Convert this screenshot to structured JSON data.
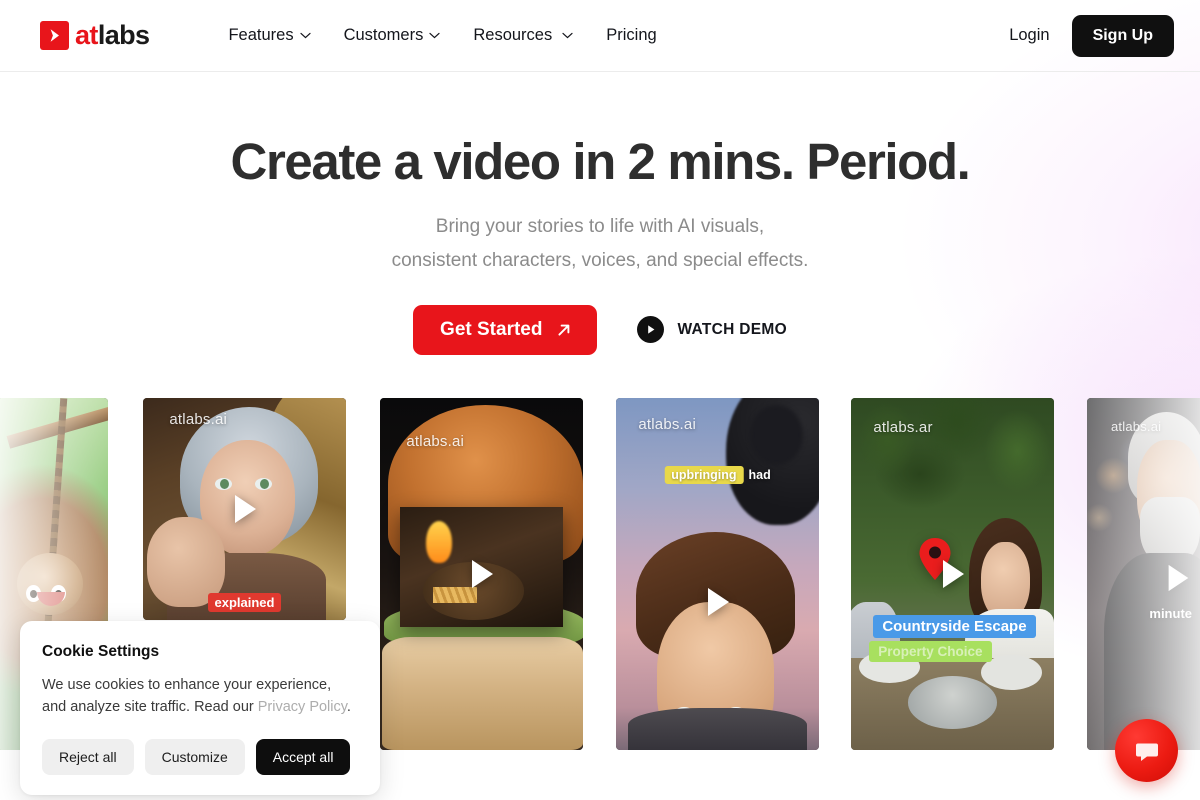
{
  "header": {
    "logo": {
      "mark": "play-triangle-icon",
      "text_primary": "at",
      "text_secondary": "labs"
    },
    "nav": [
      {
        "label": "Features",
        "has_dropdown": true,
        "icon": "chevron-down-icon"
      },
      {
        "label": "Customers",
        "has_dropdown": true,
        "icon": "chevron-down-icon"
      },
      {
        "label": "Resources",
        "has_dropdown": true,
        "icon": "chevron-down-icon"
      },
      {
        "label": "Pricing",
        "has_dropdown": false,
        "icon": ""
      }
    ],
    "login_label": "Login",
    "signup_label": "Sign Up"
  },
  "hero": {
    "heading": "Create a video in 2 mins. Period.",
    "subtitle_line1": "Bring your stories to life with AI visuals,",
    "subtitle_line2": "consistent characters, voices, and special effects.",
    "primary_cta": {
      "label": "Get Started",
      "icon": "arrow-up-right-icon"
    },
    "secondary_cta": {
      "label": "WATCH DEMO",
      "icon": "play-circle-icon"
    }
  },
  "showcase": {
    "watermark": "atlabs.ai",
    "cards": [
      {
        "id": "card-monkey",
        "subject": "animated monkey on a jungle vine",
        "watermark": "",
        "captions": []
      },
      {
        "id": "card-elderly-woman",
        "subject": "elderly woman speaking to camera",
        "watermark": "atlabs.ai",
        "captions": [
          {
            "text": "explained",
            "style": "red"
          }
        ]
      },
      {
        "id": "card-burger",
        "subject": "gourmet burger food video",
        "watermark": "atlabs.ai",
        "captions": []
      },
      {
        "id": "card-animated-boy",
        "subject": "animated boy at dusk",
        "watermark": "atlabs.ai",
        "captions": [
          {
            "text": "upbringing",
            "style": "yellow"
          },
          {
            "text": "had",
            "style": "plain"
          }
        ]
      },
      {
        "id": "card-countryside",
        "subject": "family dining outdoors in the countryside",
        "watermark": "atlabs.ar",
        "captions": [
          {
            "text": "Countryside Escape",
            "style": "blue"
          },
          {
            "text": "Property Choice",
            "style": "green"
          }
        ]
      },
      {
        "id": "card-bearded-man",
        "subject": "bearded man talking",
        "watermark": "atlabs.ai",
        "captions": [
          {
            "text": "minute",
            "style": "plain"
          }
        ]
      }
    ]
  },
  "cookie": {
    "title": "Cookie Settings",
    "body_line1": "We use cookies to enhance your experience,",
    "body_line2_prefix": "and analyze site traffic. Read our ",
    "privacy_link": "Privacy Policy",
    "body_suffix": ".",
    "reject_label": "Reject all",
    "customize_label": "Customize",
    "accept_label": "Accept all"
  },
  "chat_fab": {
    "icon": "chat-bubble-icon"
  },
  "colors": {
    "brand_red": "#e8151b",
    "dark": "#101010",
    "muted_text": "#8b8b8b",
    "heading": "#2e2e2e",
    "cookie_link": "#adadad",
    "caption_blue": "#4a9ae8",
    "caption_green": "#a8e05f",
    "caption_yellow": "#e8d84a"
  }
}
